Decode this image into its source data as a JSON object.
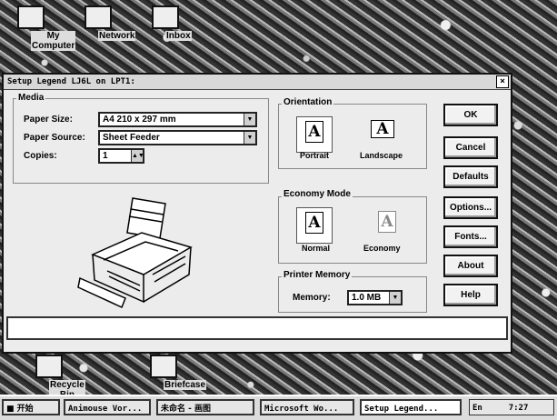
{
  "desktop": {
    "icons": [
      {
        "label": "My Computer",
        "glyph": "computer-icon"
      },
      {
        "label": "Network",
        "glyph": "network-icon"
      },
      {
        "label": "Inbox",
        "glyph": "inbox-icon"
      },
      {
        "label": "Recycle Bin",
        "glyph": "recycle-bin-icon"
      },
      {
        "label": "Briefcase",
        "glyph": "briefcase-icon"
      }
    ]
  },
  "dialog": {
    "title": "Setup  Legend LJ6L on LPT1:",
    "close_label": "×",
    "media": {
      "title": "Media",
      "paper_size_label": "Paper Size:",
      "paper_size_value": "A4 210 x 297 mm",
      "paper_source_label": "Paper Source:",
      "paper_source_value": "Sheet Feeder",
      "copies_label": "Copies:",
      "copies_value": "1"
    },
    "orientation": {
      "title": "Orientation",
      "glyph": "A",
      "portrait_label": "Portrait",
      "landscape_label": "Landscape"
    },
    "economy": {
      "title": "Economy Mode",
      "glyph": "A",
      "normal_label": "Normal",
      "economy_label": "Economy"
    },
    "memory": {
      "title": "Printer Memory",
      "label": "Memory:",
      "value": "1.0 MB"
    },
    "buttons": {
      "ok": "OK",
      "cancel": "Cancel",
      "defaults": "Defaults",
      "options": "Options...",
      "fonts": "Fonts...",
      "about": "About",
      "help": "Help"
    },
    "status_text": ""
  },
  "taskbar": {
    "start_label": "开始",
    "items": [
      "Animouse Vor...",
      "未命名 - 画图",
      "Microsoft Wo...",
      "Setup  Legend..."
    ],
    "tray_lang": "En",
    "tray_time": "7:27"
  }
}
